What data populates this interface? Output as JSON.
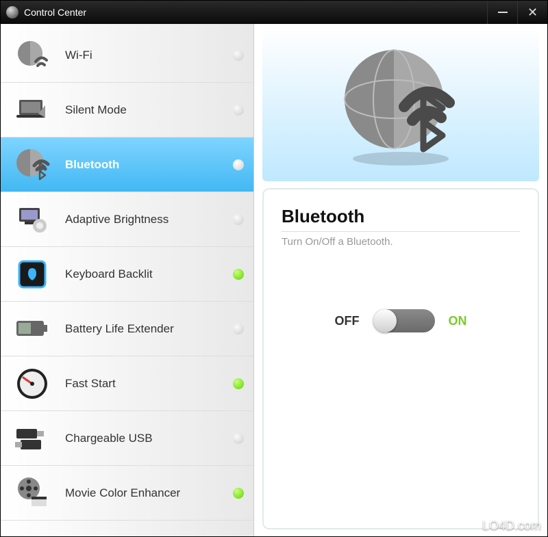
{
  "window": {
    "title": "Control Center"
  },
  "sidebar": {
    "items": [
      {
        "label": "Wi-Fi",
        "status": "off",
        "icon": "wifi-globe-icon"
      },
      {
        "label": "Silent Mode",
        "status": "off",
        "icon": "laptop-mute-icon"
      },
      {
        "label": "Bluetooth",
        "status": "sel",
        "icon": "bluetooth-globe-icon",
        "selected": true
      },
      {
        "label": "Adaptive Brightness",
        "status": "off",
        "icon": "brightness-icon"
      },
      {
        "label": "Keyboard Backlit",
        "status": "on",
        "icon": "keyboard-backlit-icon"
      },
      {
        "label": "Battery Life Extender",
        "status": "off",
        "icon": "battery-icon"
      },
      {
        "label": "Fast Start",
        "status": "on",
        "icon": "speedometer-icon"
      },
      {
        "label": "Chargeable USB",
        "status": "off",
        "icon": "usb-icon"
      },
      {
        "label": "Movie Color Enhancer",
        "status": "on",
        "icon": "film-reel-icon"
      }
    ]
  },
  "detail": {
    "hero_icon": "bluetooth-globe-icon",
    "title": "Bluetooth",
    "subtitle": "Turn On/Off a Bluetooth.",
    "toggle": {
      "off_label": "OFF",
      "on_label": "ON",
      "state": "off"
    }
  },
  "watermark": "LO4D.com",
  "colors": {
    "accent": "#42b8f3",
    "status_on": "#7acb2a"
  }
}
